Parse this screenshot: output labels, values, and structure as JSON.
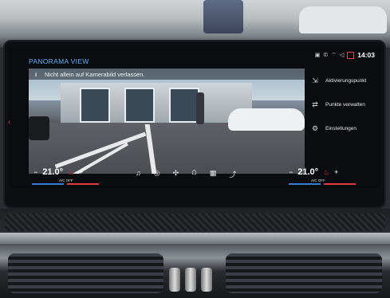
{
  "header": {
    "title": "PANORAMA VIEW",
    "time": "14:03",
    "status_icons": [
      "vehicle-icon",
      "phone-icon",
      "wifi-icon",
      "volume-mute-icon",
      "notification-icon"
    ]
  },
  "camera": {
    "notice": "Nicht allein auf Kamerabild verlassen."
  },
  "menu": {
    "items": [
      {
        "label": "Aktivierungspunkt",
        "icon": "activation-point-icon"
      },
      {
        "label": "Punkte verwalten",
        "icon": "manage-points-icon"
      },
      {
        "label": "Einstellungen",
        "icon": "gear-icon"
      }
    ]
  },
  "climate": {
    "left": {
      "temp": "21.0°",
      "minus": "−",
      "plus": "+",
      "ac": "A/C OFF"
    },
    "right": {
      "temp": "21.0°",
      "minus": "−",
      "plus": "+",
      "ac": "A/C OFF"
    }
  },
  "bottom_icons": [
    "music-icon",
    "navigation-icon",
    "fan-icon",
    "home-icon",
    "apps-icon",
    "phone-icon"
  ],
  "colors": {
    "accent": "#5fb0ff",
    "seat_heat": "#e23a3a",
    "temp_blue": "#3a7bd5"
  }
}
